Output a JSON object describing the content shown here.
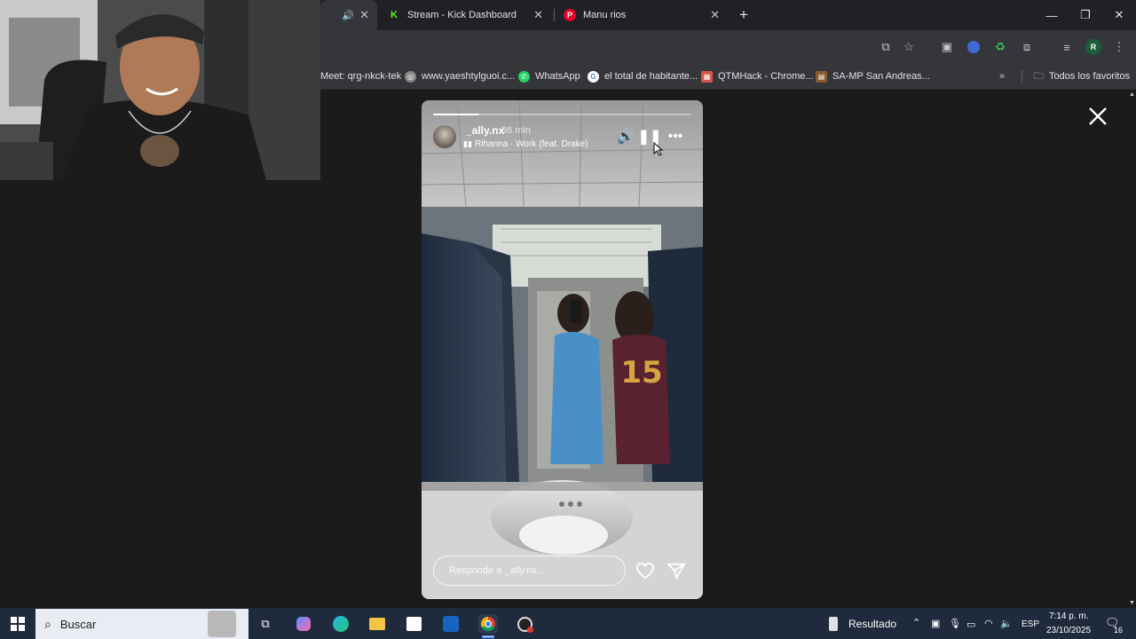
{
  "browser": {
    "tabs": [
      {
        "title": "",
        "active": true
      },
      {
        "title": "Stream - Kick Dashboard",
        "favicon": "kick-logo-icon"
      },
      {
        "title": "Manu rios",
        "favicon": "pinterest-logo-icon"
      }
    ],
    "bookmarks": [
      {
        "label": "Meet: qrg-nkck-tek"
      },
      {
        "label": "www.yaeshtylguoi.c..."
      },
      {
        "label": "WhatsApp"
      },
      {
        "label": "el total de habitante..."
      },
      {
        "label": "QTMHack - Chrome..."
      },
      {
        "label": "SA-MP San Andreas..."
      }
    ],
    "all_bookmarks_label": "Todos los favoritos",
    "profile_initial": "R"
  },
  "story": {
    "username": "_ally.nx",
    "time": "36 min",
    "song": "Rihanna · Work (feat. Drake)",
    "progress": 0.18,
    "reply_placeholder": "Responde a _ally.nx..."
  },
  "taskbar": {
    "search_placeholder": "Buscar",
    "widget_label": "Resultado",
    "language": "ESP",
    "time": "7:14 p. m.",
    "date": "23/10/2025",
    "notification_count": "16"
  },
  "colors": {
    "kick_green": "#53fc18",
    "pinterest_red": "#e60023",
    "chrome_dark": "#202124",
    "toolbar": "#35363a",
    "taskbar": "#1f2a3d"
  }
}
